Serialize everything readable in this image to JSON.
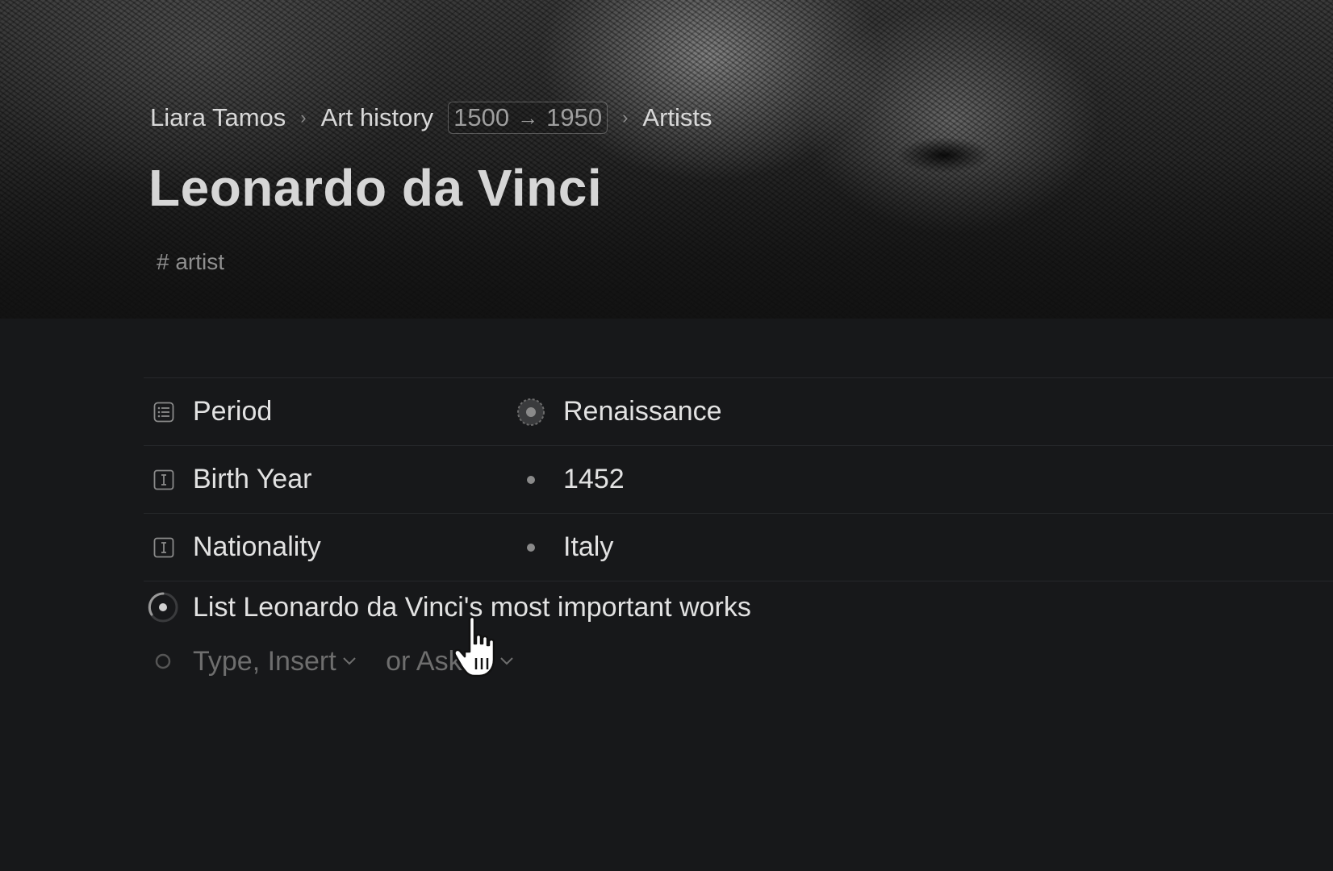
{
  "breadcrumb": {
    "items": [
      "Liara Tamos",
      "Art history"
    ],
    "date_range": {
      "start": "1500",
      "arrow": "→",
      "end": "1950"
    },
    "current": "Artists",
    "separator": "›"
  },
  "page": {
    "title": "Leonardo da Vinci",
    "tag": "# artist"
  },
  "properties": [
    {
      "icon": "list-icon",
      "name": "Period",
      "marker": "select-marker-icon",
      "value": "Renaissance"
    },
    {
      "icon": "text-field-icon",
      "name": "Birth Year",
      "marker": "dot-icon",
      "value": "1452"
    },
    {
      "icon": "text-field-icon",
      "name": "Nationality",
      "marker": "dot-icon",
      "value": "Italy"
    }
  ],
  "blocks": [
    {
      "icon": "ai-loading-icon",
      "text": "List Leonardo da Vinci's most important works"
    }
  ],
  "placeholder": {
    "part1": "Type, Insert",
    "part2": "or Ask AI"
  },
  "colors": {
    "background": "#17181a",
    "text": "#e2e2e2",
    "muted": "#6e6e6e",
    "divider": "#26282b"
  }
}
